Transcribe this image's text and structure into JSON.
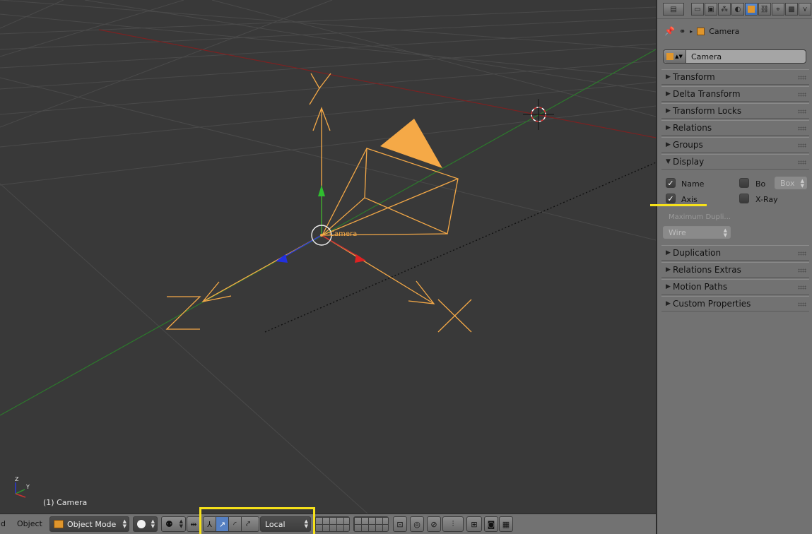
{
  "viewport": {
    "object_label": "Camera",
    "status_text": "(1) Camera",
    "axis_letters": {
      "x": "X",
      "y": "Y",
      "z": "Z"
    }
  },
  "header": {
    "menu_left_cut": "d",
    "object_menu": "Object",
    "mode": "Object Mode",
    "orientation": "Local"
  },
  "properties": {
    "breadcrumb_object": "Camera",
    "object_name": "Camera",
    "panels_top": [
      "Transform",
      "Delta Transform",
      "Transform Locks",
      "Relations",
      "Groups"
    ],
    "display_panel": {
      "title": "Display",
      "name_label": "Name",
      "name_checked": true,
      "bounds_label": "Bo",
      "bounds_checked": false,
      "bounds_type": "Box",
      "axis_label": "Axis",
      "axis_checked": true,
      "xray_label": "X-Ray",
      "xray_checked": false,
      "max_dupli_label": "Maximum Dupli...",
      "max_dupli_value": "Wire"
    },
    "panels_bottom": [
      "Duplication",
      "Relations Extras",
      "Motion Paths",
      "Custom Properties"
    ]
  },
  "colors": {
    "viewport_bg": "#393939",
    "panel_bg": "#727272",
    "selection_orange": "#f5a947",
    "highlight_yellow": "#f7e21a",
    "x_axis": "#c83232",
    "y_axis": "#2f9a2f",
    "z_axis": "#2a38d6"
  }
}
